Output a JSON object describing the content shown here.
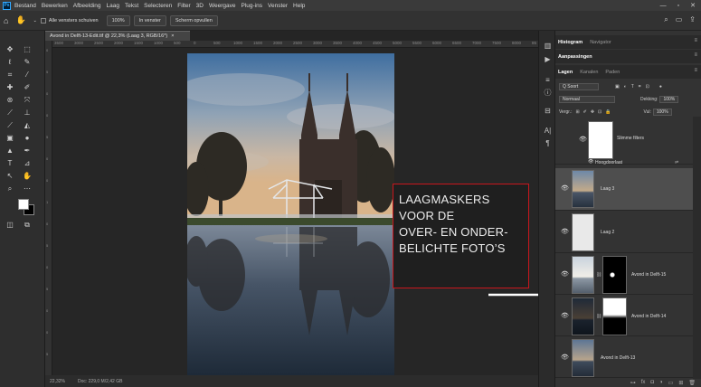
{
  "menu": {
    "logo": "Ps",
    "items": [
      "Bestand",
      "Bewerken",
      "Afbeelding",
      "Laag",
      "Tekst",
      "Selecteren",
      "Filter",
      "3D",
      "Weergave",
      "Plug-ins",
      "Venster",
      "Help"
    ]
  },
  "options": {
    "scroll_all_label": "Alle vensters schuiven",
    "zoom_value": "100%",
    "fit_button": "In venster",
    "fill_button": "Scherm opvullen"
  },
  "document": {
    "tab_title": "Avond in Delft-13-Edit.tif @ 22,3% (Laag 3, RGB/16*)",
    "close_glyph": "×"
  },
  "rulers": {
    "h_ticks": [
      "3500",
      "3000",
      "2500",
      "2000",
      "1500",
      "1000",
      "500",
      "0",
      "500",
      "1000",
      "1500",
      "2000",
      "2500",
      "3000",
      "3500",
      "4000",
      "4500",
      "5000",
      "5500",
      "6000",
      "6500",
      "7000",
      "7500",
      "8000",
      "85"
    ],
    "v_ticks": [
      "0",
      "5",
      "0",
      "0",
      "5",
      "0",
      "0",
      "1",
      "0",
      "5",
      "0",
      "5",
      "0",
      "0",
      "5"
    ]
  },
  "status": {
    "zoom": "22,32%",
    "doc": "Doc: 229,0 M/2,42 GB"
  },
  "annotation": {
    "lines": [
      "LAAGMASKERS",
      "VOOR DE",
      "OVER- EN ONDER-",
      "BELICHTE FOTO’S"
    ],
    "border_color": "#c8161d"
  },
  "panels": {
    "top_tabs": [
      "Histogram",
      "Navigator"
    ],
    "adjust_tab": "Aanpassingen",
    "layer_tabs": [
      "Lagen",
      "Kanalen",
      "Paden"
    ],
    "filter_kind": "Q Soort",
    "blend_mode": "Normaal",
    "opacity_label": "Dekking:",
    "opacity_value": "100%",
    "lock_label": "Vergr.:",
    "fill_label": "Vul:",
    "fill_value": "100%"
  },
  "layers": [
    {
      "name": "Slimme filters",
      "type": "smart-filter"
    },
    {
      "name": "Hoogdoorlaat",
      "type": "filter-entry"
    },
    {
      "name": "Laag 3",
      "type": "image",
      "selected": true
    },
    {
      "name": "Laag 2",
      "type": "gray"
    },
    {
      "name": "Avond in Delft-15",
      "type": "masked"
    },
    {
      "name": "Avond in Delft-14",
      "type": "masked"
    },
    {
      "name": "Avond in Delft-13",
      "type": "image"
    }
  ],
  "footer_icons": [
    "link-icon",
    "fx-icon",
    "mask-icon",
    "adjustment-icon",
    "folder-icon",
    "new-layer-icon",
    "trash-icon"
  ],
  "footer_glyphs": [
    "⊶",
    "fx",
    "◘",
    "◑",
    "▭",
    "⊞",
    "🗑"
  ],
  "window_controls": [
    "—",
    "▫",
    "✕"
  ],
  "accent": "#31a8ff"
}
